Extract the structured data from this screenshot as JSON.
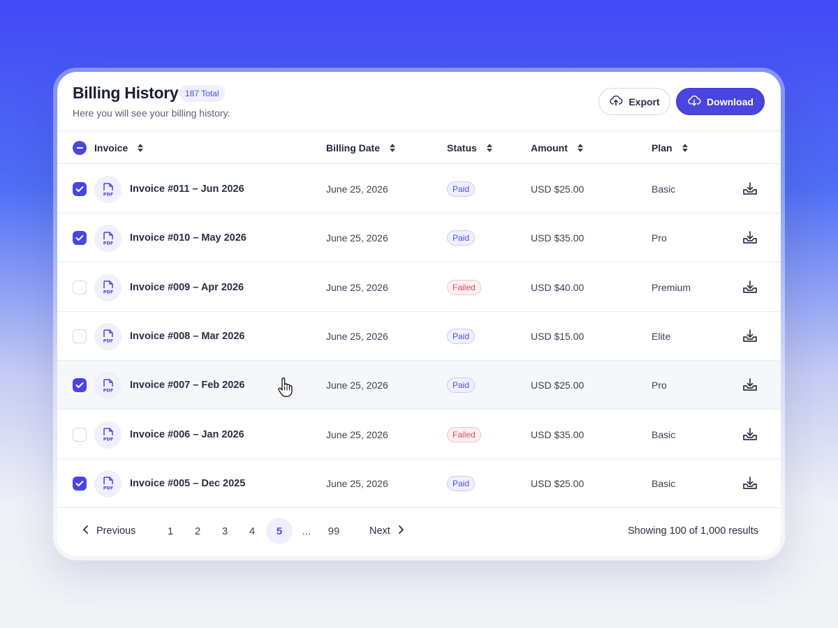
{
  "header": {
    "title": "Billing History",
    "total_badge": "187 Total",
    "subtitle": "Here you will see your billing history.",
    "export_label": "Export",
    "download_label": "Download"
  },
  "columns": {
    "invoice": "Invoice",
    "billing_date": "Billing Date",
    "status": "Status",
    "amount": "Amount",
    "plan": "Plan"
  },
  "icons": {
    "export": "cloud-upload-icon",
    "download": "cloud-download-icon",
    "file": "pdf-file-icon",
    "row_download": "tray-download-icon",
    "sort": "sort-arrows-icon"
  },
  "colors": {
    "accent": "#4a44e0",
    "paid": "#4a4fd8",
    "failed": "#e0465e"
  },
  "rows": [
    {
      "checked": true,
      "name": "Invoice #011 – Jun 2026",
      "date": "June 25, 2026",
      "status": "Paid",
      "amount": "USD $25.00",
      "plan": "Basic"
    },
    {
      "checked": true,
      "name": "Invoice #010 – May 2026",
      "date": "June 25, 2026",
      "status": "Paid",
      "amount": "USD $35.00",
      "plan": "Pro"
    },
    {
      "checked": false,
      "name": "Invoice #009 – Apr 2026",
      "date": "June 25, 2026",
      "status": "Failed",
      "amount": "USD $40.00",
      "plan": "Premium"
    },
    {
      "checked": false,
      "name": "Invoice #008 – Mar 2026",
      "date": "June 25, 2026",
      "status": "Paid",
      "amount": "USD $15.00",
      "plan": "Elite"
    },
    {
      "checked": true,
      "name": "Invoice #007 – Feb 2026",
      "date": "June 25, 2026",
      "status": "Paid",
      "amount": "USD $25.00",
      "plan": "Pro"
    },
    {
      "checked": false,
      "name": "Invoice #006 – Jan 2026",
      "date": "June 25, 2026",
      "status": "Failed",
      "amount": "USD $35.00",
      "plan": "Basic"
    },
    {
      "checked": true,
      "name": "Invoice #005 – Dec 2025",
      "date": "June 25, 2026",
      "status": "Paid",
      "amount": "USD $25.00",
      "plan": "Basic"
    }
  ],
  "pagination": {
    "previous": "Previous",
    "next": "Next",
    "pages": [
      "1",
      "2",
      "3",
      "4",
      "5",
      "...",
      "99"
    ],
    "current": "5",
    "results_text": "Showing 100 of 1,000 results"
  }
}
